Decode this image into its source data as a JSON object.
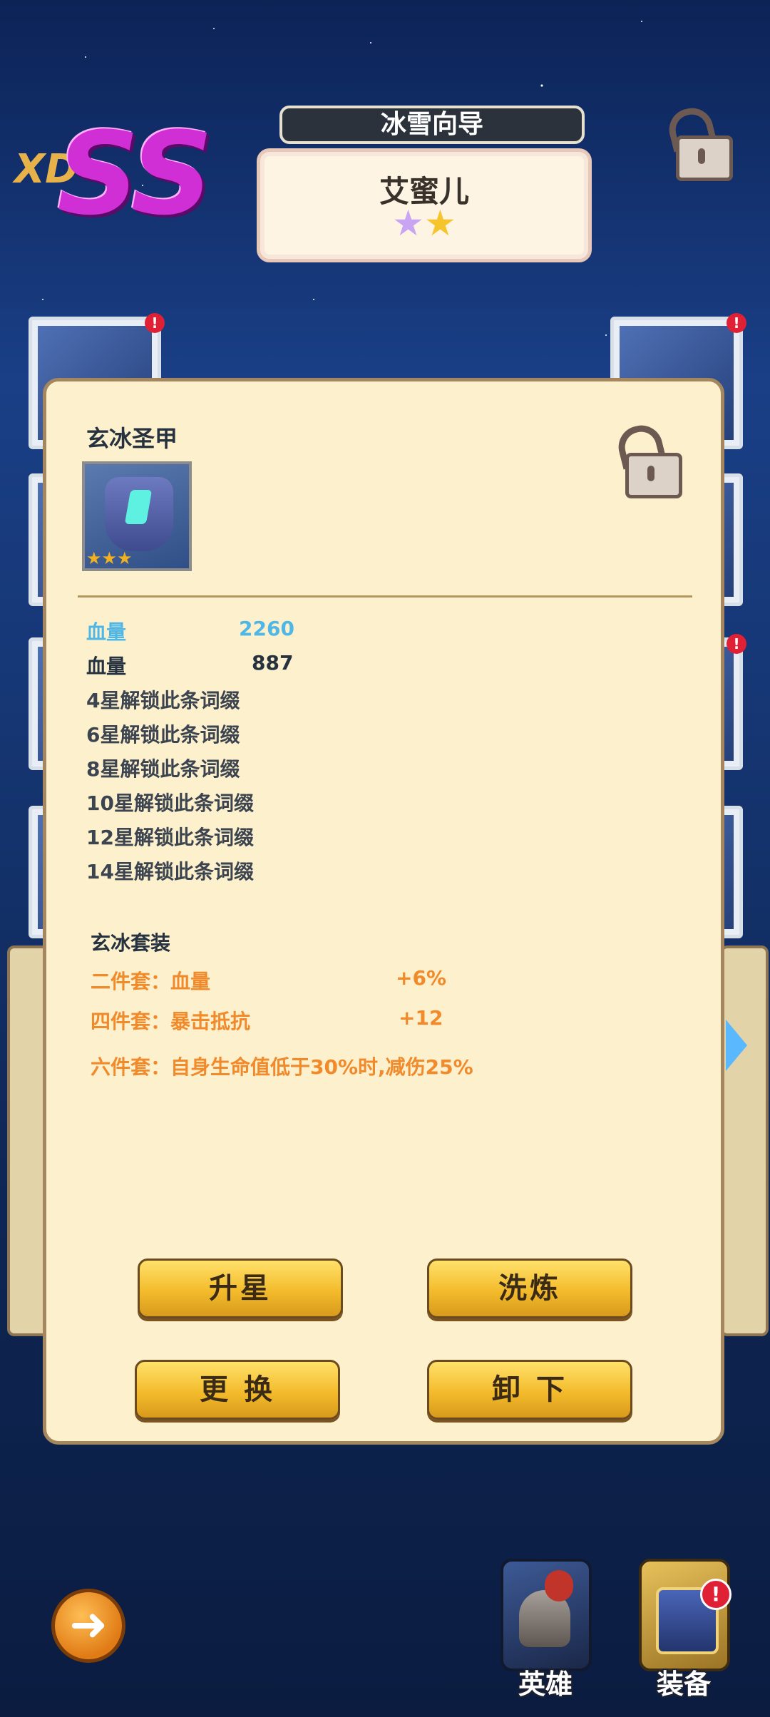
{
  "header": {
    "rank_prefix": "XD",
    "rank": "SS",
    "hero_class": "冰雪向导",
    "hero_name": "艾蜜儿",
    "hero_stars": "★★"
  },
  "equipment_panel": {
    "title": "玄冰圣甲",
    "item_stars": "★★★",
    "stats": [
      {
        "label": "血量",
        "value": "2260",
        "color": "#4fb7e6"
      },
      {
        "label": "血量",
        "value": "887",
        "color": "#263240"
      }
    ],
    "locked_affixes": [
      "4星解锁此条词缀",
      "6星解锁此条词缀",
      "8星解锁此条词缀",
      "10星解锁此条词缀",
      "12星解锁此条词缀",
      "14星解锁此条词缀"
    ],
    "set": {
      "name": "玄冰套装",
      "bonuses": [
        {
          "label": "二件套：血量",
          "value": "+6%"
        },
        {
          "label": "四件套：暴击抵抗",
          "value": "+12"
        },
        {
          "label": "六件套：自身生命值低于30%时,减伤25%",
          "value": ""
        }
      ],
      "color": "#f08a2a"
    },
    "buttons": {
      "upgrade_star": "升星",
      "refine": "洗炼",
      "replace": "更 换",
      "unequip": "卸 下"
    }
  },
  "slot_badge": "!",
  "bottom_nav": {
    "back_icon": "back-arrow-icon",
    "hero_tab": "英雄",
    "equipment_tab": "装备",
    "equipment_badge": "!"
  },
  "colors": {
    "panel_bg": "#fdf0cd",
    "accent_gold": "#f3bb2c",
    "badge_red": "#e02035"
  }
}
